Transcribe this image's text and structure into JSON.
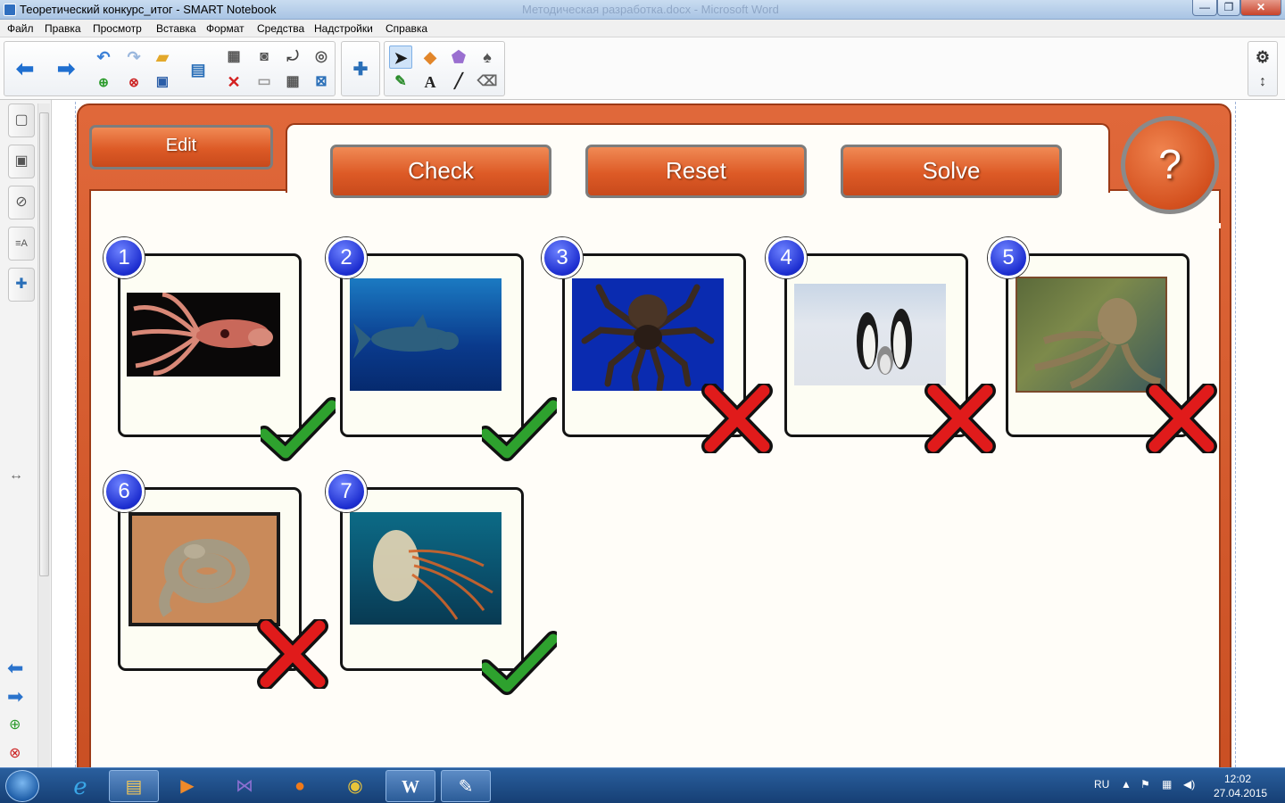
{
  "window": {
    "title": "Теоретический конкурс_итог - SMART Notebook",
    "background_title": "Методическая разработка.docx - Microsoft Word",
    "controls": {
      "minimize": "—",
      "maximize": "❐",
      "close": "✕"
    }
  },
  "menu": [
    "Файл",
    "Правка",
    "Просмотр",
    "Вставка",
    "Формат",
    "Средства",
    "Надстройки",
    "Справка"
  ],
  "toolbar": {
    "icons": [
      "arrow-back-icon",
      "arrow-forward-icon",
      "undo-icon",
      "redo-icon",
      "open-icon",
      "add-page-icon",
      "delete-page-icon",
      "save-icon",
      "display-icon",
      "paste-icon",
      "delete-icon",
      "screen-shade-icon",
      "table-icon",
      "capture-icon",
      "tool-crop-icon",
      "screen-capture-icon",
      "clear-icon",
      "addon-icon",
      "select-icon",
      "shapes-icon",
      "fill-icon",
      "magic-pen-icon",
      "pens-icon",
      "text-icon",
      "line-icon",
      "eraser-icon",
      "settings-icon",
      "move-toolbar-icon"
    ]
  },
  "sidebar": {
    "tabs": [
      "page-sorter-icon",
      "gallery-icon",
      "attachments-icon",
      "properties-icon",
      "addons-icon"
    ],
    "bottom": [
      "prev-page-icon",
      "next-page-icon",
      "add-page-icon",
      "delete-page-icon"
    ]
  },
  "activity": {
    "edit_label": "Edit",
    "buttons": {
      "check": "Check",
      "reset": "Reset",
      "solve": "Solve"
    },
    "help_label": "?",
    "cards": [
      {
        "number": "1",
        "subject": "squid",
        "result": "correct"
      },
      {
        "number": "2",
        "subject": "whale shark",
        "result": "correct"
      },
      {
        "number": "3",
        "subject": "tarantula",
        "result": "incorrect"
      },
      {
        "number": "4",
        "subject": "penguins",
        "result": "incorrect"
      },
      {
        "number": "5",
        "subject": "octopus",
        "result": "incorrect"
      },
      {
        "number": "6",
        "subject": "viper",
        "result": "incorrect"
      },
      {
        "number": "7",
        "subject": "jellyfish",
        "result": "correct"
      }
    ],
    "colors": {
      "frame": "#d95a2b",
      "correct": "#2ea12e",
      "incorrect": "#e01b1b",
      "badge": "#1d2ed0"
    }
  },
  "taskbar": {
    "apps": [
      "windows-start-icon",
      "internet-explorer-icon",
      "file-explorer-icon",
      "media-player-icon",
      "visual-studio-icon",
      "firefox-icon",
      "chrome-icon",
      "word-icon",
      "smart-notebook-icon"
    ],
    "language": "RU",
    "time": "12:02",
    "date": "27.04.2015"
  }
}
